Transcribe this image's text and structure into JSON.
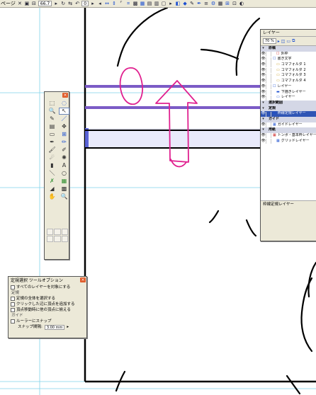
{
  "toolbar": {
    "page_label": "ページ",
    "zoom_value": "66.7",
    "angle_value": "0"
  },
  "tool_palette": {
    "tools": [
      {
        "name": "rect-select-tool",
        "glyph": "⬚"
      },
      {
        "name": "lasso-tool",
        "glyph": "◌"
      },
      {
        "name": "zoom-tool",
        "glyph": "🔍"
      },
      {
        "name": "pointer-tool",
        "glyph": "↖"
      },
      {
        "name": "eyedropper-tool",
        "glyph": "✎"
      },
      {
        "name": "pen-line-tool",
        "glyph": "／"
      },
      {
        "name": "ruler-tool",
        "glyph": "▤"
      },
      {
        "name": "move-tool",
        "glyph": "✥"
      },
      {
        "name": "frame-tool",
        "glyph": "▭"
      },
      {
        "name": "grid-tool",
        "glyph": "⊞"
      },
      {
        "name": "pen-tool",
        "glyph": "✒"
      },
      {
        "name": "pencil-tool",
        "glyph": "✏"
      },
      {
        "name": "brush-tool",
        "glyph": "🖌"
      },
      {
        "name": "marker-tool",
        "glyph": "✐"
      },
      {
        "name": "airbrush-tool",
        "glyph": "☄"
      },
      {
        "name": "blur-tool",
        "glyph": "✺"
      },
      {
        "name": "fill-tool",
        "glyph": "▮"
      },
      {
        "name": "text-tool",
        "glyph": "A"
      },
      {
        "name": "line-tool",
        "glyph": "＼"
      },
      {
        "name": "ellipse-tool",
        "glyph": "○"
      },
      {
        "name": "eraser-tool",
        "glyph": "✗"
      },
      {
        "name": "tone-tool",
        "glyph": "▦"
      },
      {
        "name": "gradient-tool",
        "glyph": "◢"
      },
      {
        "name": "pattern-tool",
        "glyph": "▩"
      },
      {
        "name": "hand-tool",
        "glyph": "✋"
      },
      {
        "name": "magnify-tool",
        "glyph": "🔍"
      }
    ]
  },
  "layer_panel": {
    "title": "レイヤー",
    "opacity": "70 %",
    "rows": [
      {
        "type": "section",
        "label": "原稿"
      },
      {
        "type": "layer",
        "icon": "☐",
        "icon_color": "red",
        "label": "外枠",
        "indent": 1
      },
      {
        "type": "layer",
        "icon": "☐",
        "icon_color": "blue",
        "label": "書き文字",
        "indent": 0
      },
      {
        "type": "layer",
        "icon": "▭",
        "icon_color": "folder",
        "label": "コマフォルダ 1",
        "indent": 1
      },
      {
        "type": "layer",
        "icon": "▭",
        "icon_color": "folder",
        "label": "コマフォルダ 2",
        "indent": 1
      },
      {
        "type": "layer",
        "icon": "▭",
        "icon_color": "folder",
        "label": "コマフォルダ 3",
        "indent": 1
      },
      {
        "type": "layer",
        "icon": "▭",
        "icon_color": "folder",
        "label": "コマフォルダ 4",
        "indent": 1
      },
      {
        "type": "layer",
        "icon": "☐",
        "icon_color": "blue",
        "label": "レイヤー",
        "indent": 0
      },
      {
        "type": "layer",
        "icon": "▬",
        "icon_color": "blue",
        "label": "下描きレイヤー",
        "indent": 1
      },
      {
        "type": "layer",
        "icon": "▭",
        "icon_color": "blue",
        "label": "レイヤー",
        "indent": 1
      },
      {
        "type": "section",
        "label": "選択範囲"
      },
      {
        "type": "section",
        "label": "定規"
      },
      {
        "type": "layer",
        "icon": "▧",
        "icon_color": "blue",
        "label": "枠線定規レイヤー",
        "indent": 0,
        "active": true
      },
      {
        "type": "section",
        "label": "ガイド"
      },
      {
        "type": "layer",
        "icon": "▦",
        "icon_color": "blue",
        "label": "ガイドレイヤー",
        "indent": 0
      },
      {
        "type": "section",
        "label": "用紙"
      },
      {
        "type": "layer",
        "icon": "▦",
        "icon_color": "red",
        "label": "トンボ・基本枠レイヤー",
        "indent": 0
      },
      {
        "type": "layer",
        "icon": "▦",
        "icon_color": "blue",
        "label": "グリッドレイヤー",
        "indent": 1
      }
    ],
    "status": "枠線定規レイヤー"
  },
  "tool_options": {
    "title": "定規選択 ツールオプション",
    "all_layers": "すべてのレイヤーを対象にする",
    "ruler_group": "定規",
    "opt1": "定規の全体を選択する",
    "opt2": "クリックした辺に頂点を追加する",
    "opt3": "頂点移動時に他の頂点に揃える",
    "guide_group": "ガイド",
    "snap_label": "ルーラーにスナップ",
    "snap_interval_label": "スナップ間隔:",
    "snap_value": "3.00 mm"
  },
  "colors": {
    "ui_bg": "#ece9d8",
    "guide_cyan": "#7fd3ea",
    "ruler_purple": "#7b5bc6",
    "annotation_magenta": "#e0208f",
    "layer_active": "#2f55b5"
  }
}
